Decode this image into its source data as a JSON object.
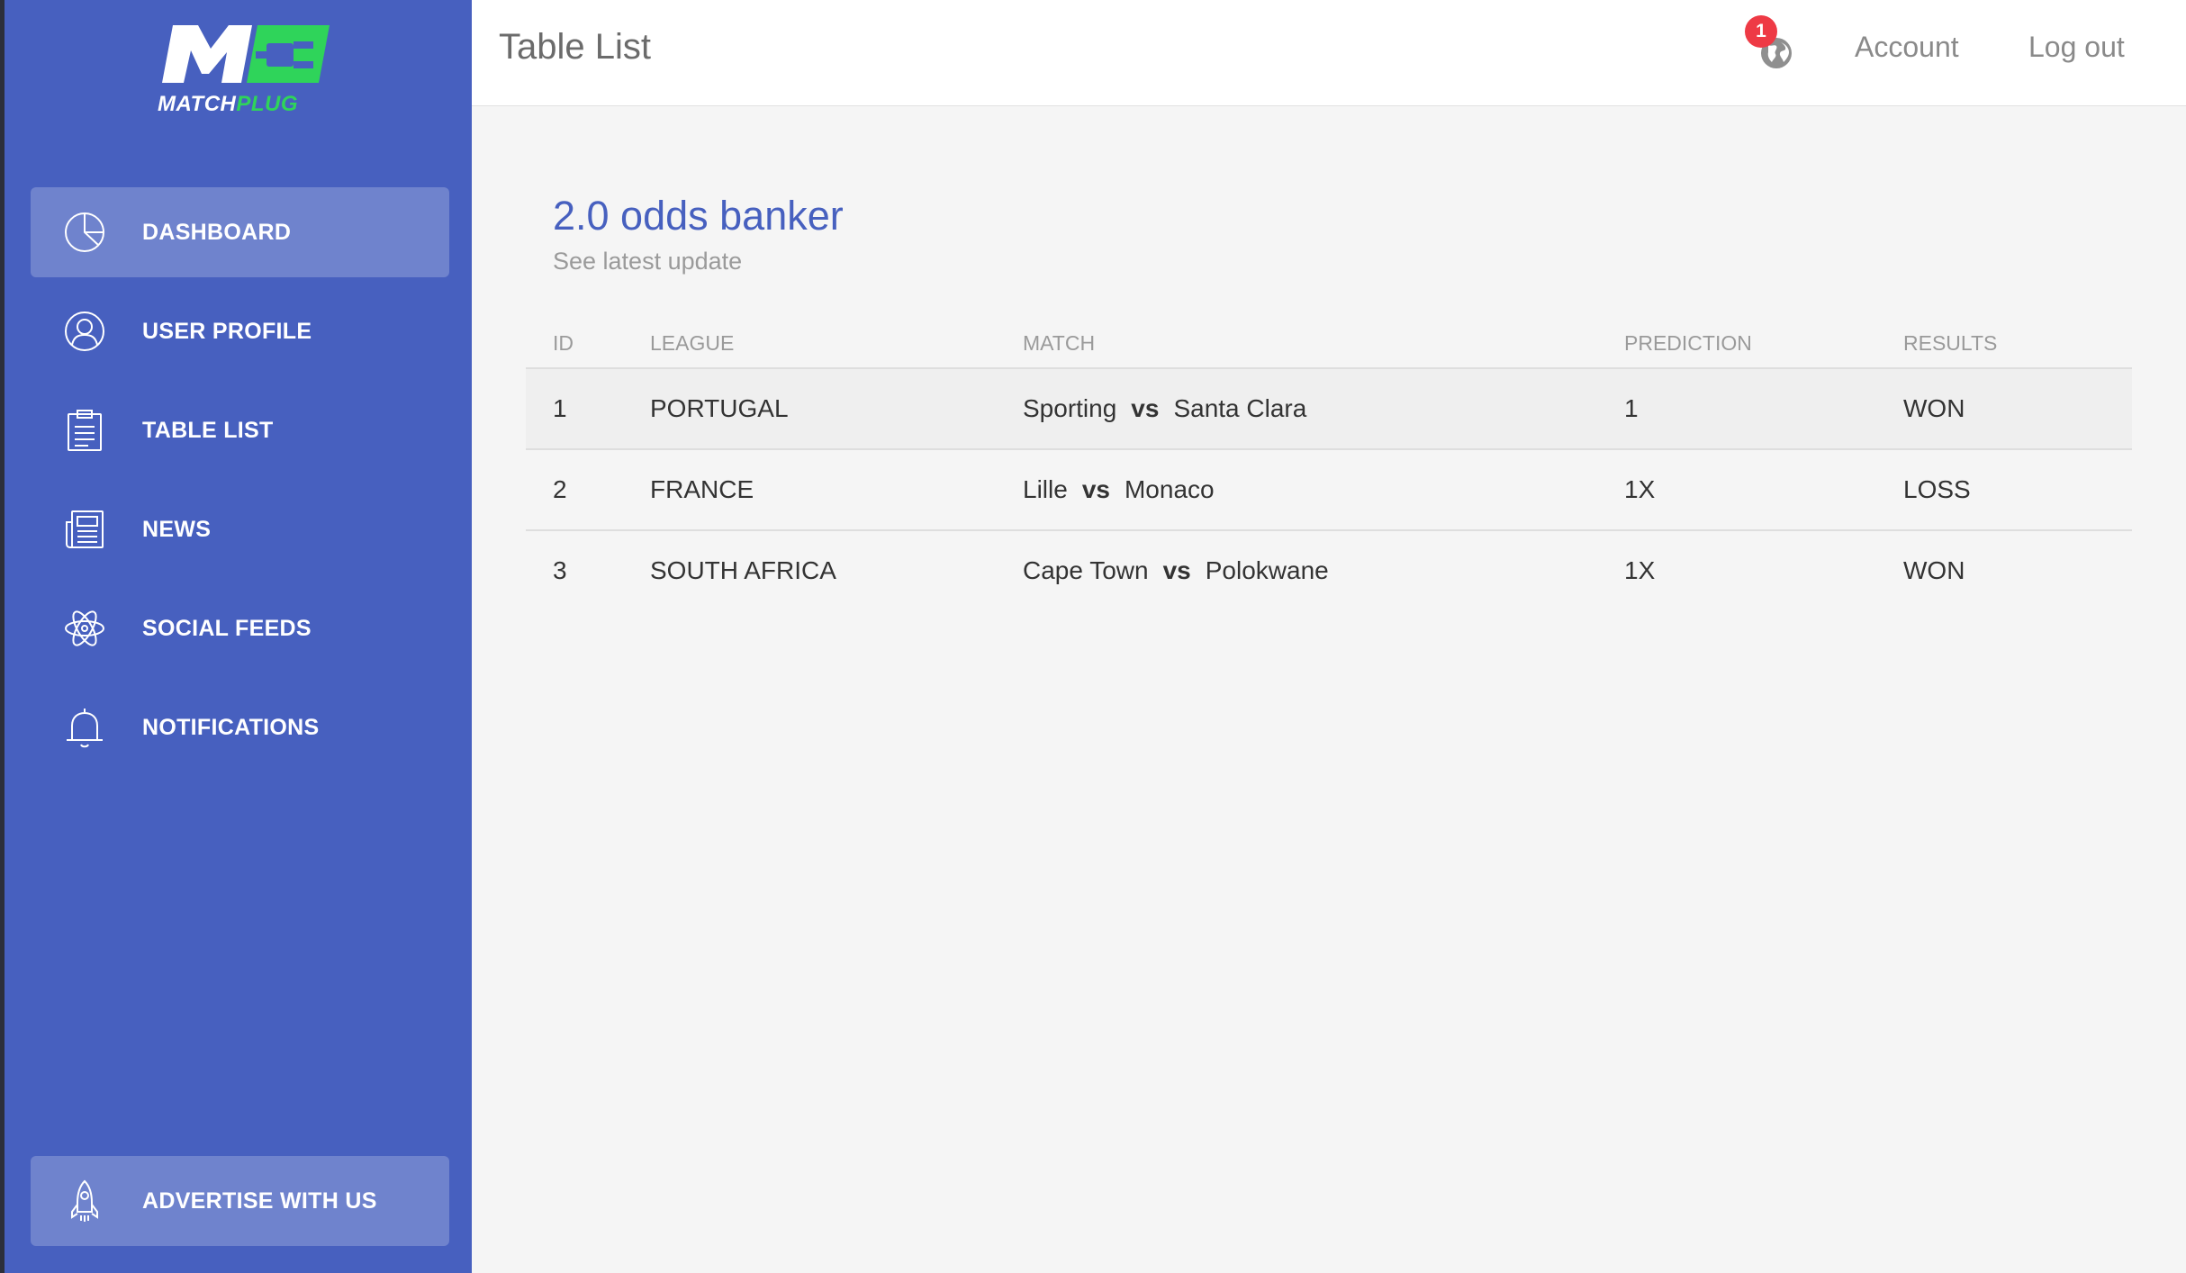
{
  "brand": {
    "part1": "MATCH",
    "part2": "PLUG",
    "mark_text": "M"
  },
  "colors": {
    "sidebar": "#4760bf",
    "accent_green": "#2fd45a",
    "badge": "#ee3a45",
    "title_blue": "#4760bf"
  },
  "sidebar": {
    "items": [
      {
        "label": "DASHBOARD",
        "icon": "pie-chart-icon",
        "active": true
      },
      {
        "label": "USER PROFILE",
        "icon": "user-icon",
        "active": false
      },
      {
        "label": "TABLE LIST",
        "icon": "clipboard-icon",
        "active": false
      },
      {
        "label": "NEWS",
        "icon": "newspaper-icon",
        "active": false
      },
      {
        "label": "SOCIAL FEEDS",
        "icon": "atom-icon",
        "active": false
      },
      {
        "label": "NOTIFICATIONS",
        "icon": "bell-icon",
        "active": false
      }
    ],
    "bottom": {
      "label": "ADVERTISE WITH US",
      "icon": "rocket-icon"
    }
  },
  "header": {
    "title": "Table List",
    "notification_count": "1",
    "account_label": "Account",
    "logout_label": "Log out"
  },
  "card": {
    "title": "2.0 odds banker",
    "subtitle": "See latest update",
    "columns": [
      "ID",
      "LEAGUE",
      "MATCH",
      "PREDICTION",
      "RESULTS"
    ],
    "rows": [
      {
        "id": "1",
        "league": "PORTUGAL",
        "home": "Sporting",
        "vs": "vs",
        "away": "Santa Clara",
        "prediction": "1",
        "result": "WON"
      },
      {
        "id": "2",
        "league": "FRANCE",
        "home": "Lille",
        "vs": "vs",
        "away": "Monaco",
        "prediction": "1X",
        "result": "LOSS"
      },
      {
        "id": "3",
        "league": "SOUTH AFRICA",
        "home": "Cape Town",
        "vs": "vs",
        "away": "Polokwane",
        "prediction": "1X",
        "result": "WON"
      }
    ]
  }
}
